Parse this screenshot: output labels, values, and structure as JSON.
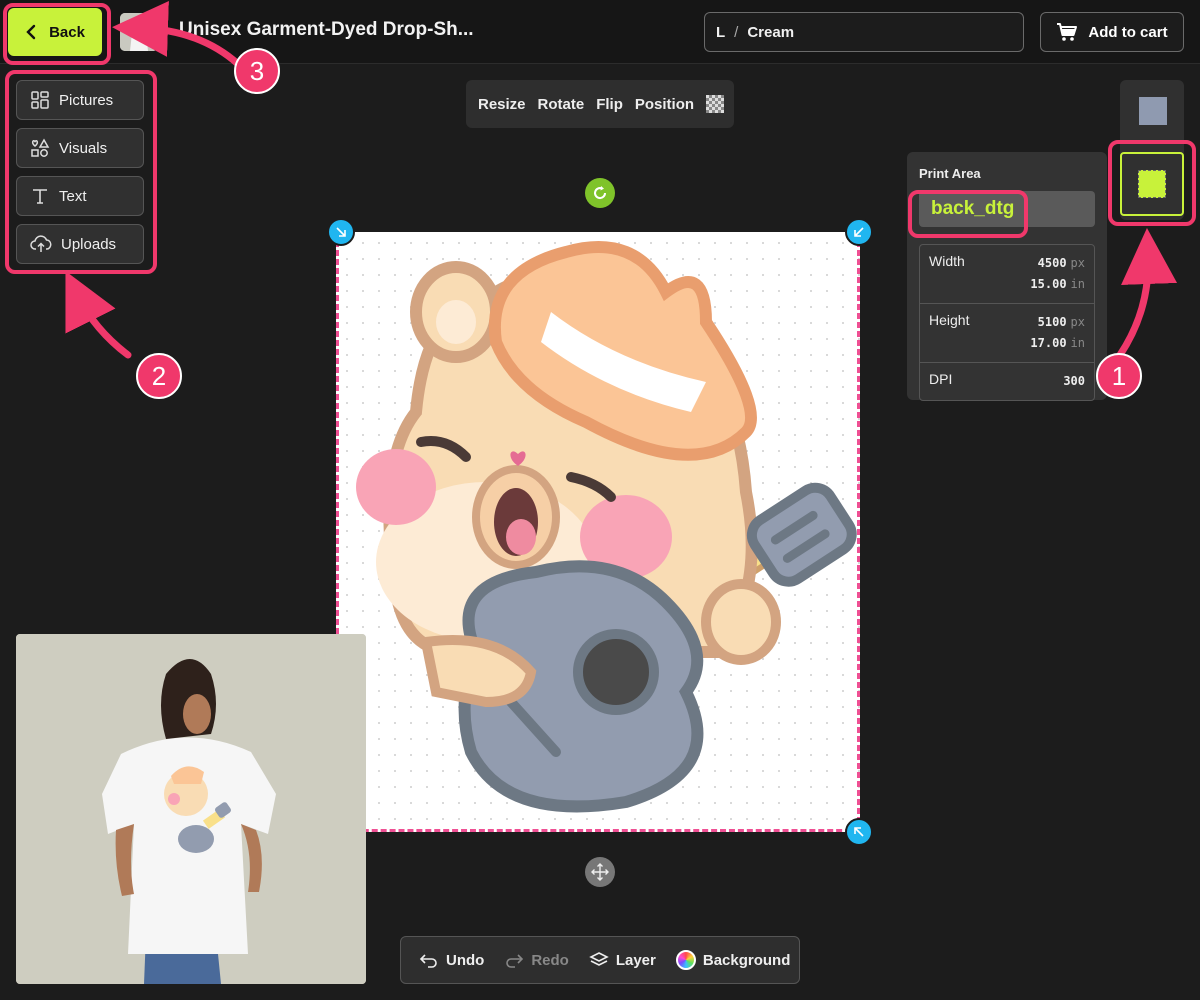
{
  "header": {
    "back_label": "Back",
    "product_title": "Unisex Garment-Dyed Drop-Sh...",
    "variant_size": "L",
    "variant_separator": "/",
    "variant_color": "Cream",
    "cart_label": "Add to cart"
  },
  "tools": {
    "items": [
      {
        "label": "Pictures",
        "icon": "grid-icon"
      },
      {
        "label": "Visuals",
        "icon": "shapes-icon"
      },
      {
        "label": "Text",
        "icon": "text-icon"
      },
      {
        "label": "Uploads",
        "icon": "upload-cloud-icon"
      }
    ]
  },
  "transform_toolbar": {
    "resize": "Resize",
    "rotate": "Rotate",
    "flip": "Flip",
    "position": "Position"
  },
  "print_area": {
    "label": "Print Area",
    "name": "back_dtg",
    "width_label": "Width",
    "width_px": "4500",
    "width_in": "15.00",
    "height_label": "Height",
    "height_px": "5100",
    "height_in": "17.00",
    "dpi_label": "DPI",
    "dpi_value": "300",
    "unit_px": "px",
    "unit_in": "in"
  },
  "annotations": {
    "n1": "1",
    "n2": "2",
    "n3": "3"
  },
  "bottom_bar": {
    "undo": "Undo",
    "redo": "Redo",
    "layer": "Layer",
    "background": "Background"
  },
  "colors": {
    "accent": "#c8f23a",
    "highlight": "#f0386b",
    "handle": "#20b6f0"
  }
}
